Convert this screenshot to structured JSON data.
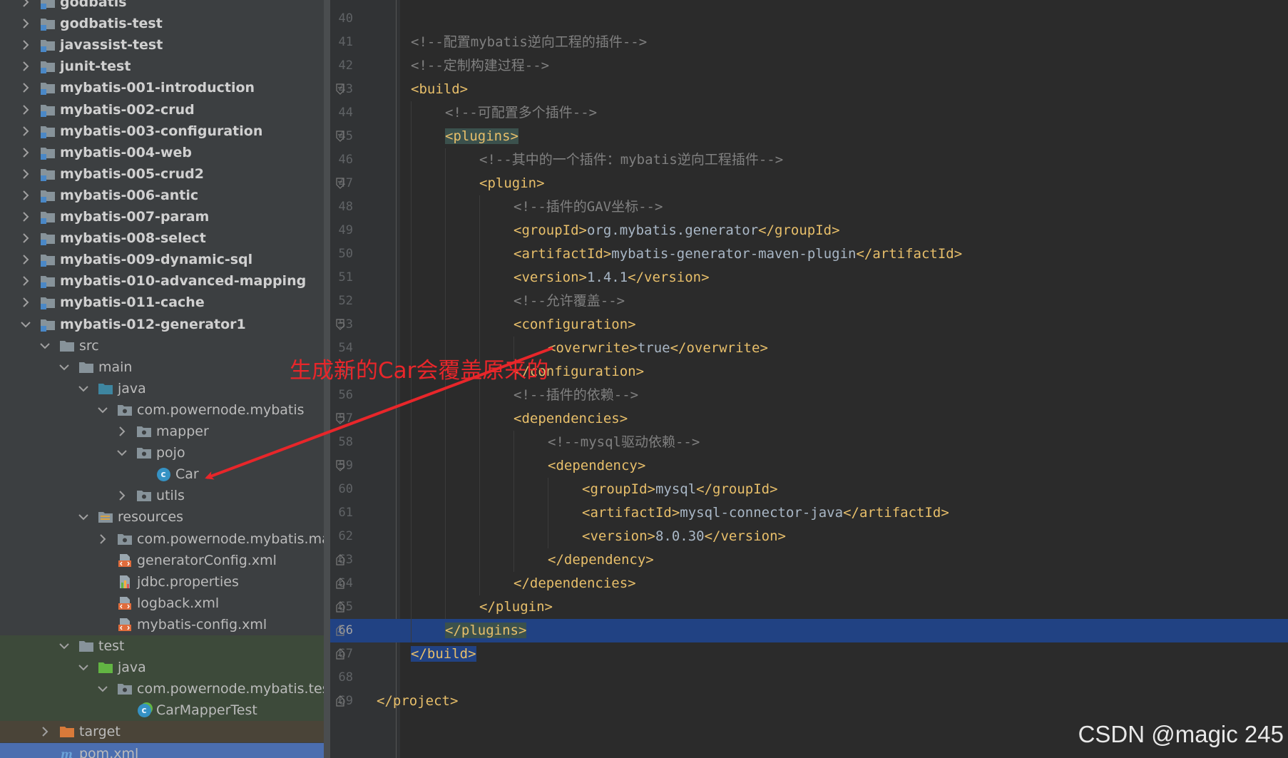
{
  "tree": {
    "items": [
      {
        "label": "godbatis",
        "kind": "module",
        "depth": 0,
        "arrow": "right",
        "bold": true
      },
      {
        "label": "godbatis-test",
        "kind": "module",
        "depth": 0,
        "arrow": "right",
        "bold": true
      },
      {
        "label": "javassist-test",
        "kind": "module",
        "depth": 0,
        "arrow": "right",
        "bold": true
      },
      {
        "label": "junit-test",
        "kind": "module",
        "depth": 0,
        "arrow": "right",
        "bold": true
      },
      {
        "label": "mybatis-001-introduction",
        "kind": "module",
        "depth": 0,
        "arrow": "right",
        "bold": true
      },
      {
        "label": "mybatis-002-crud",
        "kind": "module",
        "depth": 0,
        "arrow": "right",
        "bold": true
      },
      {
        "label": "mybatis-003-configuration",
        "kind": "module",
        "depth": 0,
        "arrow": "right",
        "bold": true
      },
      {
        "label": "mybatis-004-web",
        "kind": "module",
        "depth": 0,
        "arrow": "right",
        "bold": true
      },
      {
        "label": "mybatis-005-crud2",
        "kind": "module",
        "depth": 0,
        "arrow": "right",
        "bold": true
      },
      {
        "label": "mybatis-006-antic",
        "kind": "module",
        "depth": 0,
        "arrow": "right",
        "bold": true
      },
      {
        "label": "mybatis-007-param",
        "kind": "module",
        "depth": 0,
        "arrow": "right",
        "bold": true
      },
      {
        "label": "mybatis-008-select",
        "kind": "module",
        "depth": 0,
        "arrow": "right",
        "bold": true
      },
      {
        "label": "mybatis-009-dynamic-sql",
        "kind": "module",
        "depth": 0,
        "arrow": "right",
        "bold": true
      },
      {
        "label": "mybatis-010-advanced-mapping",
        "kind": "module",
        "depth": 0,
        "arrow": "right",
        "bold": true
      },
      {
        "label": "mybatis-011-cache",
        "kind": "module",
        "depth": 0,
        "arrow": "right",
        "bold": true
      },
      {
        "label": "mybatis-012-generator1",
        "kind": "module",
        "depth": 0,
        "arrow": "down",
        "bold": true
      },
      {
        "label": "src",
        "kind": "folder",
        "depth": 1,
        "arrow": "down"
      },
      {
        "label": "main",
        "kind": "folder",
        "depth": 2,
        "arrow": "down"
      },
      {
        "label": "java",
        "kind": "source-folder",
        "depth": 3,
        "arrow": "down"
      },
      {
        "label": "com.powernode.mybatis",
        "kind": "package",
        "depth": 4,
        "arrow": "down"
      },
      {
        "label": "mapper",
        "kind": "package",
        "depth": 5,
        "arrow": "right"
      },
      {
        "label": "pojo",
        "kind": "package",
        "depth": 5,
        "arrow": "down"
      },
      {
        "label": "Car",
        "kind": "class",
        "depth": 6,
        "arrow": "none"
      },
      {
        "label": "utils",
        "kind": "package",
        "depth": 5,
        "arrow": "right"
      },
      {
        "label": "resources",
        "kind": "resources-folder",
        "depth": 3,
        "arrow": "down"
      },
      {
        "label": "com.powernode.mybatis.mapper",
        "kind": "package",
        "depth": 4,
        "arrow": "right"
      },
      {
        "label": "generatorConfig.xml",
        "kind": "xml",
        "depth": 4,
        "arrow": "none"
      },
      {
        "label": "jdbc.properties",
        "kind": "properties",
        "depth": 4,
        "arrow": "none"
      },
      {
        "label": "logback.xml",
        "kind": "xml",
        "depth": 4,
        "arrow": "none"
      },
      {
        "label": "mybatis-config.xml",
        "kind": "xml",
        "depth": 4,
        "arrow": "none"
      },
      {
        "label": "test",
        "kind": "folder",
        "depth": 2,
        "arrow": "down",
        "hl": "test"
      },
      {
        "label": "java",
        "kind": "test-folder",
        "depth": 3,
        "arrow": "down",
        "hl": "test"
      },
      {
        "label": "com.powernode.mybatis.test",
        "kind": "package",
        "depth": 4,
        "arrow": "down",
        "hl": "test"
      },
      {
        "label": "CarMapperTest",
        "kind": "test-class",
        "depth": 5,
        "arrow": "none",
        "hl": "test"
      },
      {
        "label": "target",
        "kind": "excluded-folder",
        "depth": 1,
        "arrow": "right",
        "hl": "excl"
      },
      {
        "label": "pom.xml",
        "kind": "maven",
        "depth": 1,
        "arrow": "none",
        "hl": "sel"
      }
    ]
  },
  "editor": {
    "lines": [
      {
        "num": "40",
        "indent": 0,
        "parts": []
      },
      {
        "num": "41",
        "indent": 1,
        "parts": [
          {
            "t": "cmt",
            "v": "<!--配置mybatis逆向工程的插件-->"
          }
        ]
      },
      {
        "num": "42",
        "indent": 1,
        "parts": [
          {
            "t": "cmt",
            "v": "<!--定制构建过程-->"
          }
        ]
      },
      {
        "num": "43",
        "indent": 1,
        "fold": "open",
        "parts": [
          {
            "t": "tag",
            "v": "<build>"
          }
        ]
      },
      {
        "num": "44",
        "indent": 2,
        "parts": [
          {
            "t": "cmt",
            "v": "<!--可配置多个插件-->"
          }
        ]
      },
      {
        "num": "45",
        "indent": 2,
        "fold": "open",
        "parts": [
          {
            "t": "tag bm",
            "v": "<plugins>"
          }
        ]
      },
      {
        "num": "46",
        "indent": 3,
        "parts": [
          {
            "t": "cmt",
            "v": "<!--其中的一个插件：mybatis逆向工程插件-->"
          }
        ]
      },
      {
        "num": "47",
        "indent": 3,
        "fold": "open",
        "parts": [
          {
            "t": "tag",
            "v": "<plugin>"
          }
        ]
      },
      {
        "num": "48",
        "indent": 4,
        "parts": [
          {
            "t": "cmt",
            "v": "<!--插件的GAV坐标-->"
          }
        ]
      },
      {
        "num": "49",
        "indent": 4,
        "parts": [
          {
            "t": "tag",
            "v": "<groupId>"
          },
          {
            "t": "txt",
            "v": "org.mybatis.generator"
          },
          {
            "t": "tag",
            "v": "</groupId>"
          }
        ]
      },
      {
        "num": "50",
        "indent": 4,
        "parts": [
          {
            "t": "tag",
            "v": "<artifactId>"
          },
          {
            "t": "txt",
            "v": "mybatis-generator-maven-plugin"
          },
          {
            "t": "tag",
            "v": "</artifactId>"
          }
        ]
      },
      {
        "num": "51",
        "indent": 4,
        "parts": [
          {
            "t": "tag",
            "v": "<version>"
          },
          {
            "t": "txt",
            "v": "1.4.1"
          },
          {
            "t": "tag",
            "v": "</version>"
          }
        ]
      },
      {
        "num": "52",
        "indent": 4,
        "parts": [
          {
            "t": "cmt",
            "v": "<!--允许覆盖-->"
          }
        ]
      },
      {
        "num": "53",
        "indent": 4,
        "fold": "open",
        "parts": [
          {
            "t": "tag",
            "v": "<configuration>"
          }
        ]
      },
      {
        "num": "54",
        "indent": 5,
        "parts": [
          {
            "t": "tag",
            "v": "<overwrite>"
          },
          {
            "t": "txt",
            "v": "true"
          },
          {
            "t": "tag",
            "v": "</overwrite>"
          }
        ]
      },
      {
        "num": "55",
        "indent": 4,
        "parts": [
          {
            "t": "tag",
            "v": "</configuration>"
          }
        ]
      },
      {
        "num": "56",
        "indent": 4,
        "parts": [
          {
            "t": "cmt",
            "v": "<!--插件的依赖-->"
          }
        ]
      },
      {
        "num": "57",
        "indent": 4,
        "fold": "open",
        "parts": [
          {
            "t": "tag",
            "v": "<dependencies>"
          }
        ]
      },
      {
        "num": "58",
        "indent": 5,
        "parts": [
          {
            "t": "cmt",
            "v": "<!--mysql驱动依赖-->"
          }
        ]
      },
      {
        "num": "59",
        "indent": 5,
        "fold": "open",
        "parts": [
          {
            "t": "tag",
            "v": "<dependency>"
          }
        ]
      },
      {
        "num": "60",
        "indent": 6,
        "parts": [
          {
            "t": "tag",
            "v": "<groupId>"
          },
          {
            "t": "txt",
            "v": "mysql"
          },
          {
            "t": "tag",
            "v": "</groupId>"
          }
        ]
      },
      {
        "num": "61",
        "indent": 6,
        "parts": [
          {
            "t": "tag",
            "v": "<artifactId>"
          },
          {
            "t": "txt",
            "v": "mysql-connector-java"
          },
          {
            "t": "tag",
            "v": "</artifactId>"
          }
        ]
      },
      {
        "num": "62",
        "indent": 6,
        "parts": [
          {
            "t": "tag",
            "v": "<version>"
          },
          {
            "t": "txt",
            "v": "8.0.30"
          },
          {
            "t": "tag",
            "v": "</version>"
          }
        ]
      },
      {
        "num": "63",
        "indent": 5,
        "fold": "close",
        "parts": [
          {
            "t": "tag",
            "v": "</dependency>"
          }
        ]
      },
      {
        "num": "64",
        "indent": 4,
        "fold": "close",
        "parts": [
          {
            "t": "tag",
            "v": "</dependencies>"
          }
        ]
      },
      {
        "num": "65",
        "indent": 3,
        "fold": "close",
        "parts": [
          {
            "t": "tag",
            "v": "</plugin>"
          }
        ]
      },
      {
        "num": "66",
        "indent": 2,
        "fold": "close",
        "current": true,
        "parts": [
          {
            "t": "tag bm",
            "v": "</plugins>"
          }
        ]
      },
      {
        "num": "67",
        "indent": 1,
        "fold": "close",
        "parts": [
          {
            "t": "tag sel-build",
            "v": "</build>"
          }
        ]
      },
      {
        "num": "68",
        "indent": 0,
        "parts": []
      },
      {
        "num": "69",
        "indent": 0,
        "fold": "close",
        "parts": [
          {
            "t": "tag",
            "v": "</project>"
          }
        ]
      }
    ]
  },
  "annotation": {
    "text": "生成新的Car会覆盖原来的",
    "color": "#e8262a"
  },
  "watermark": {
    "text": "CSDN @magic 245"
  },
  "colors": {
    "tag": "#e8bf6a",
    "text": "#a9b7c6",
    "comment": "#808080",
    "selection": "#214283",
    "panel": "#3c3f41",
    "editor": "#2b2b2b"
  }
}
